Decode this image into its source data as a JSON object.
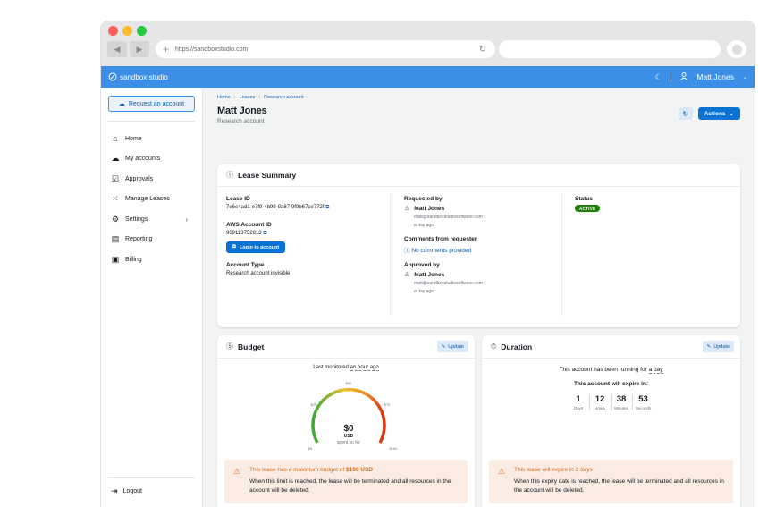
{
  "browser": {
    "url": "https://sandboxstudio.com",
    "back": "◀",
    "forward": "▶"
  },
  "topnav": {
    "brand": "sandbox studio",
    "user": "Matt Jones"
  },
  "sidebar": {
    "request_label": "Request an account",
    "items": [
      {
        "label": "Home",
        "icon": "home-icon"
      },
      {
        "label": "My accounts",
        "icon": "cloud-icon"
      },
      {
        "label": "Approvals",
        "icon": "check-box-icon"
      },
      {
        "label": "Manage Leases",
        "icon": "grid-icon"
      },
      {
        "label": "Settings",
        "icon": "gear-icon"
      },
      {
        "label": "Reporting",
        "icon": "report-icon"
      },
      {
        "label": "Billing",
        "icon": "billing-icon"
      }
    ],
    "logout": "Logout"
  },
  "breadcrumb": {
    "items": [
      "Home",
      "Leases",
      "Research account"
    ]
  },
  "page": {
    "title": "Matt Jones",
    "subtitle": "Research account",
    "actions_label": "Actions"
  },
  "lease_summary": {
    "title": "Lease Summary",
    "lease_id_label": "Lease ID",
    "lease_id": "7e6e4ad1-e7f9-4b99-9a87-9f9b67ce772f",
    "aws_label": "AWS Account ID",
    "aws_id": "969113752813",
    "login_label": "Login to account",
    "type_label": "Account Type",
    "type_value": "Research account invisible",
    "requested_label": "Requested by",
    "requester_name": "Matt Jones",
    "requester_email": "matt@sandboxstudiosoftware.com",
    "requested_ago": "a day ago",
    "comments_label": "Comments from requester",
    "comments_value": "No comments provided",
    "approved_label": "Approved by",
    "approver_name": "Matt Jones",
    "approver_email": "matt@sandboxstudiosoftware.com",
    "approved_ago": "a day ago",
    "status_label": "Status",
    "status_value": "ACTIVE"
  },
  "budget": {
    "title": "Budget",
    "update_label": "Update",
    "last_monitored_label": "Last monitored",
    "last_monitored_value": "an hour ago",
    "gauge": {
      "spent": "$0",
      "unit": "USD",
      "caption": "spent so far",
      "ticks": [
        "$0",
        "$25",
        "$50",
        "$75",
        "$100"
      ],
      "fraction_spent": 0.0
    },
    "warn_title_prefix": "This lease has a maximum budget of",
    "warn_title_amount": "$100 USD",
    "warn_desc": "When this limit is reached, the lease will be terminated and all resources in the account will be deleted."
  },
  "duration": {
    "title": "Duration",
    "update_label": "Update",
    "running_prefix": "This account has been running for",
    "running_value": "a day",
    "expire_label": "This account will expire in:",
    "timer": [
      {
        "value": "1",
        "label": "Days"
      },
      {
        "value": "12",
        "label": "Hours"
      },
      {
        "value": "38",
        "label": "Minutes"
      },
      {
        "value": "53",
        "label": "Seconds"
      }
    ],
    "warn_title_prefix": "This lease will expire",
    "warn_title_value": "in 2 days",
    "warn_desc": "When this expiry date is reached, the lease will be terminated and all resources in the account will be deleted."
  },
  "colors": {
    "accent": "#0972d3",
    "topnav": "#3d8ee6",
    "active": "#1d8102",
    "warning": "#d86a1e"
  }
}
